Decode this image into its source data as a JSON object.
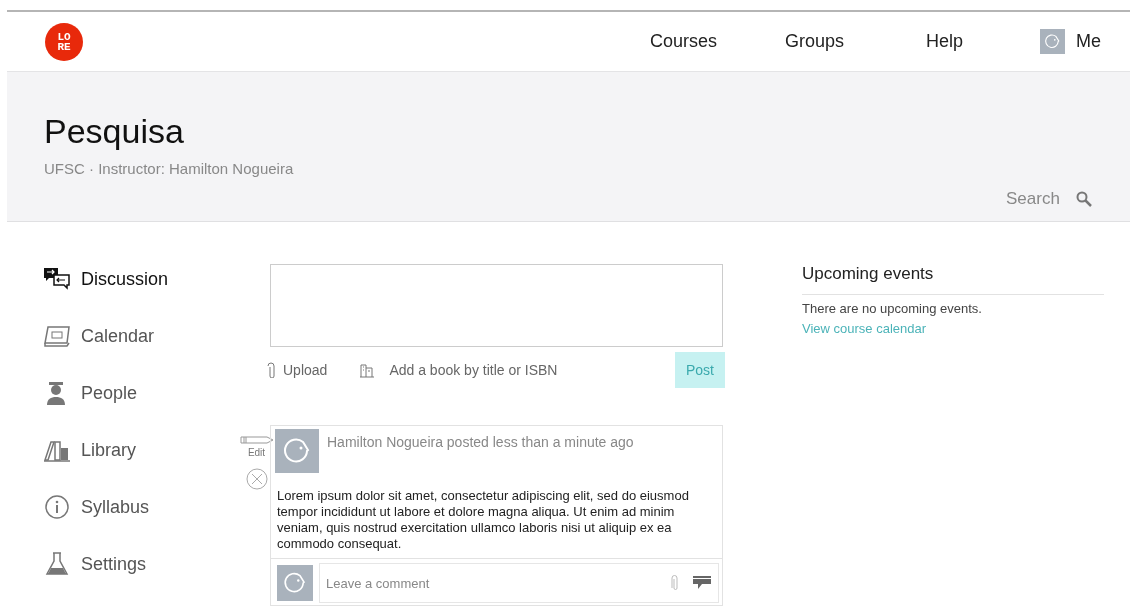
{
  "logo": {
    "lines": [
      "LO",
      "RE"
    ]
  },
  "nav": [
    {
      "label": "Courses"
    },
    {
      "label": "Groups"
    },
    {
      "label": "Help"
    },
    {
      "label": "Me",
      "kind": "avatar"
    }
  ],
  "course": {
    "title": "Pesquisa",
    "subtitle": "UFSC · Instructor: Hamilton Nogueira",
    "search": {
      "placeholder": "Search"
    }
  },
  "sidebar": {
    "items": [
      {
        "label": "Discussion",
        "selected": true
      },
      {
        "label": "Calendar",
        "selected": false
      },
      {
        "label": "People",
        "selected": false
      },
      {
        "label": "Library",
        "selected": false
      },
      {
        "label": "Syllabus",
        "selected": false
      },
      {
        "label": "Settings",
        "selected": false
      }
    ]
  },
  "composer": {
    "upload": "Upload",
    "book_placeholder": "Add a book by title or ISBN",
    "post": "Post"
  },
  "post": {
    "edit": "Edit",
    "header": "Hamilton Nogueira posted less than a minute ago",
    "body": "Lorem ipsum dolor sit amet, consectetur adipiscing elit, sed do eiusmod tempor incididunt ut labore et dolore magna aliqua. Ut enim ad minim veniam, quis nostrud exercitation ullamco laboris nisi ut aliquip ex ea commodo consequat.",
    "comment_placeholder": "Leave a comment"
  },
  "events": {
    "title": "Upcoming events",
    "empty": "There are no upcoming events.",
    "link": "View course calendar"
  }
}
